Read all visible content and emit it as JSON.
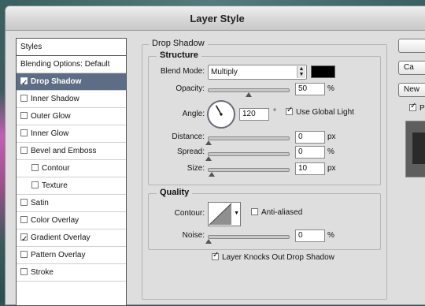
{
  "window": {
    "title": "Layer Style"
  },
  "styles": {
    "header": "Styles",
    "blending": "Blending Options: Default",
    "items": [
      {
        "label": "Drop Shadow",
        "checked": true
      },
      {
        "label": "Inner Shadow",
        "checked": false
      },
      {
        "label": "Outer Glow",
        "checked": false
      },
      {
        "label": "Inner Glow",
        "checked": false
      },
      {
        "label": "Bevel and Emboss",
        "checked": false
      },
      {
        "label": "Contour",
        "checked": false
      },
      {
        "label": "Texture",
        "checked": false
      },
      {
        "label": "Satin",
        "checked": false
      },
      {
        "label": "Color Overlay",
        "checked": false
      },
      {
        "label": "Gradient Overlay",
        "checked": true
      },
      {
        "label": "Pattern Overlay",
        "checked": false
      },
      {
        "label": "Stroke",
        "checked": false
      }
    ]
  },
  "drop_shadow": {
    "title": "Drop Shadow",
    "structure": {
      "title": "Structure",
      "blend_mode_label": "Blend Mode:",
      "blend_mode_value": "Multiply",
      "shadow_color": "#000000",
      "opacity_label": "Opacity:",
      "opacity_value": "50",
      "opacity_level": 50,
      "angle_label": "Angle:",
      "angle_value": "120",
      "angle_unit": "°",
      "global_light_label": "Use Global Light",
      "global_light_checked": true,
      "distance_label": "Distance:",
      "distance_value": "0",
      "distance_unit": "px",
      "spread_label": "Spread:",
      "spread_value": "0",
      "spread_unit": "%",
      "size_label": "Size:",
      "size_value": "10",
      "size_unit": "px",
      "percent_unit": "%"
    },
    "quality": {
      "title": "Quality",
      "contour_label": "Contour:",
      "anti_aliased_label": "Anti-aliased",
      "anti_aliased_checked": false,
      "noise_label": "Noise:",
      "noise_value": "0",
      "noise_unit": "%"
    },
    "knockout_label": "Layer Knocks Out Drop Shadow",
    "knockout_checked": true
  },
  "buttons": {
    "cancel": "Ca",
    "new_style": "New"
  },
  "preview_checkbox_label": "P"
}
